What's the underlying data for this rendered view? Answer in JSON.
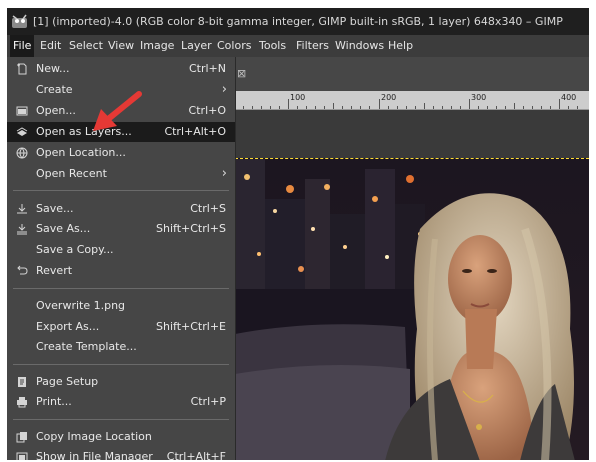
{
  "window": {
    "title": "[1] (imported)-4.0 (RGB color 8-bit gamma integer, GIMP built-in sRGB, 1 layer) 648x340 – GIMP",
    "app_icon": "gimp-wilber-icon"
  },
  "menubar": [
    "File",
    "Edit",
    "Select",
    "View",
    "Image",
    "Layer",
    "Colors",
    "Tools",
    "Filters",
    "Windows",
    "Help"
  ],
  "file_menu": {
    "new": {
      "label": "New...",
      "shortcut": "Ctrl+N",
      "icon": "new-image-icon"
    },
    "create": {
      "label": "Create"
    },
    "open": {
      "label": "Open...",
      "shortcut": "Ctrl+O",
      "icon": "open-icon"
    },
    "open_as_layers": {
      "label": "Open as Layers...",
      "shortcut": "Ctrl+Alt+O",
      "icon": "open-as-layers-icon"
    },
    "open_location": {
      "label": "Open Location...",
      "icon": "web-location-icon"
    },
    "open_recent": {
      "label": "Open Recent"
    },
    "save": {
      "label": "Save...",
      "shortcut": "Ctrl+S",
      "icon": "save-icon"
    },
    "save_as": {
      "label": "Save As...",
      "shortcut": "Shift+Ctrl+S",
      "icon": "save-as-icon"
    },
    "save_copy": {
      "label": "Save a Copy..."
    },
    "revert": {
      "label": "Revert",
      "icon": "revert-icon"
    },
    "overwrite": {
      "label": "Overwrite 1.png"
    },
    "export_as": {
      "label": "Export As...",
      "shortcut": "Shift+Ctrl+E"
    },
    "create_template": {
      "label": "Create Template..."
    },
    "page_setup": {
      "label": "Page Setup",
      "icon": "page-setup-icon"
    },
    "print": {
      "label": "Print...",
      "shortcut": "Ctrl+P",
      "icon": "print-icon"
    },
    "copy_location": {
      "label": "Copy Image Location",
      "icon": "copy-location-icon"
    },
    "show_in_file_manager": {
      "label": "Show in File Manager",
      "shortcut": "Ctrl+Alt+F",
      "icon": "file-manager-icon"
    }
  },
  "ruler": {
    "labels": [
      "100",
      "200",
      "300",
      "400"
    ]
  },
  "tab": {
    "close_glyph": "⊠"
  },
  "colors": {
    "menu_bg": "#464646",
    "highlight": "#1b1b1b",
    "arrow": "#e53935",
    "selection_marching_ants": "#ffdd33"
  }
}
